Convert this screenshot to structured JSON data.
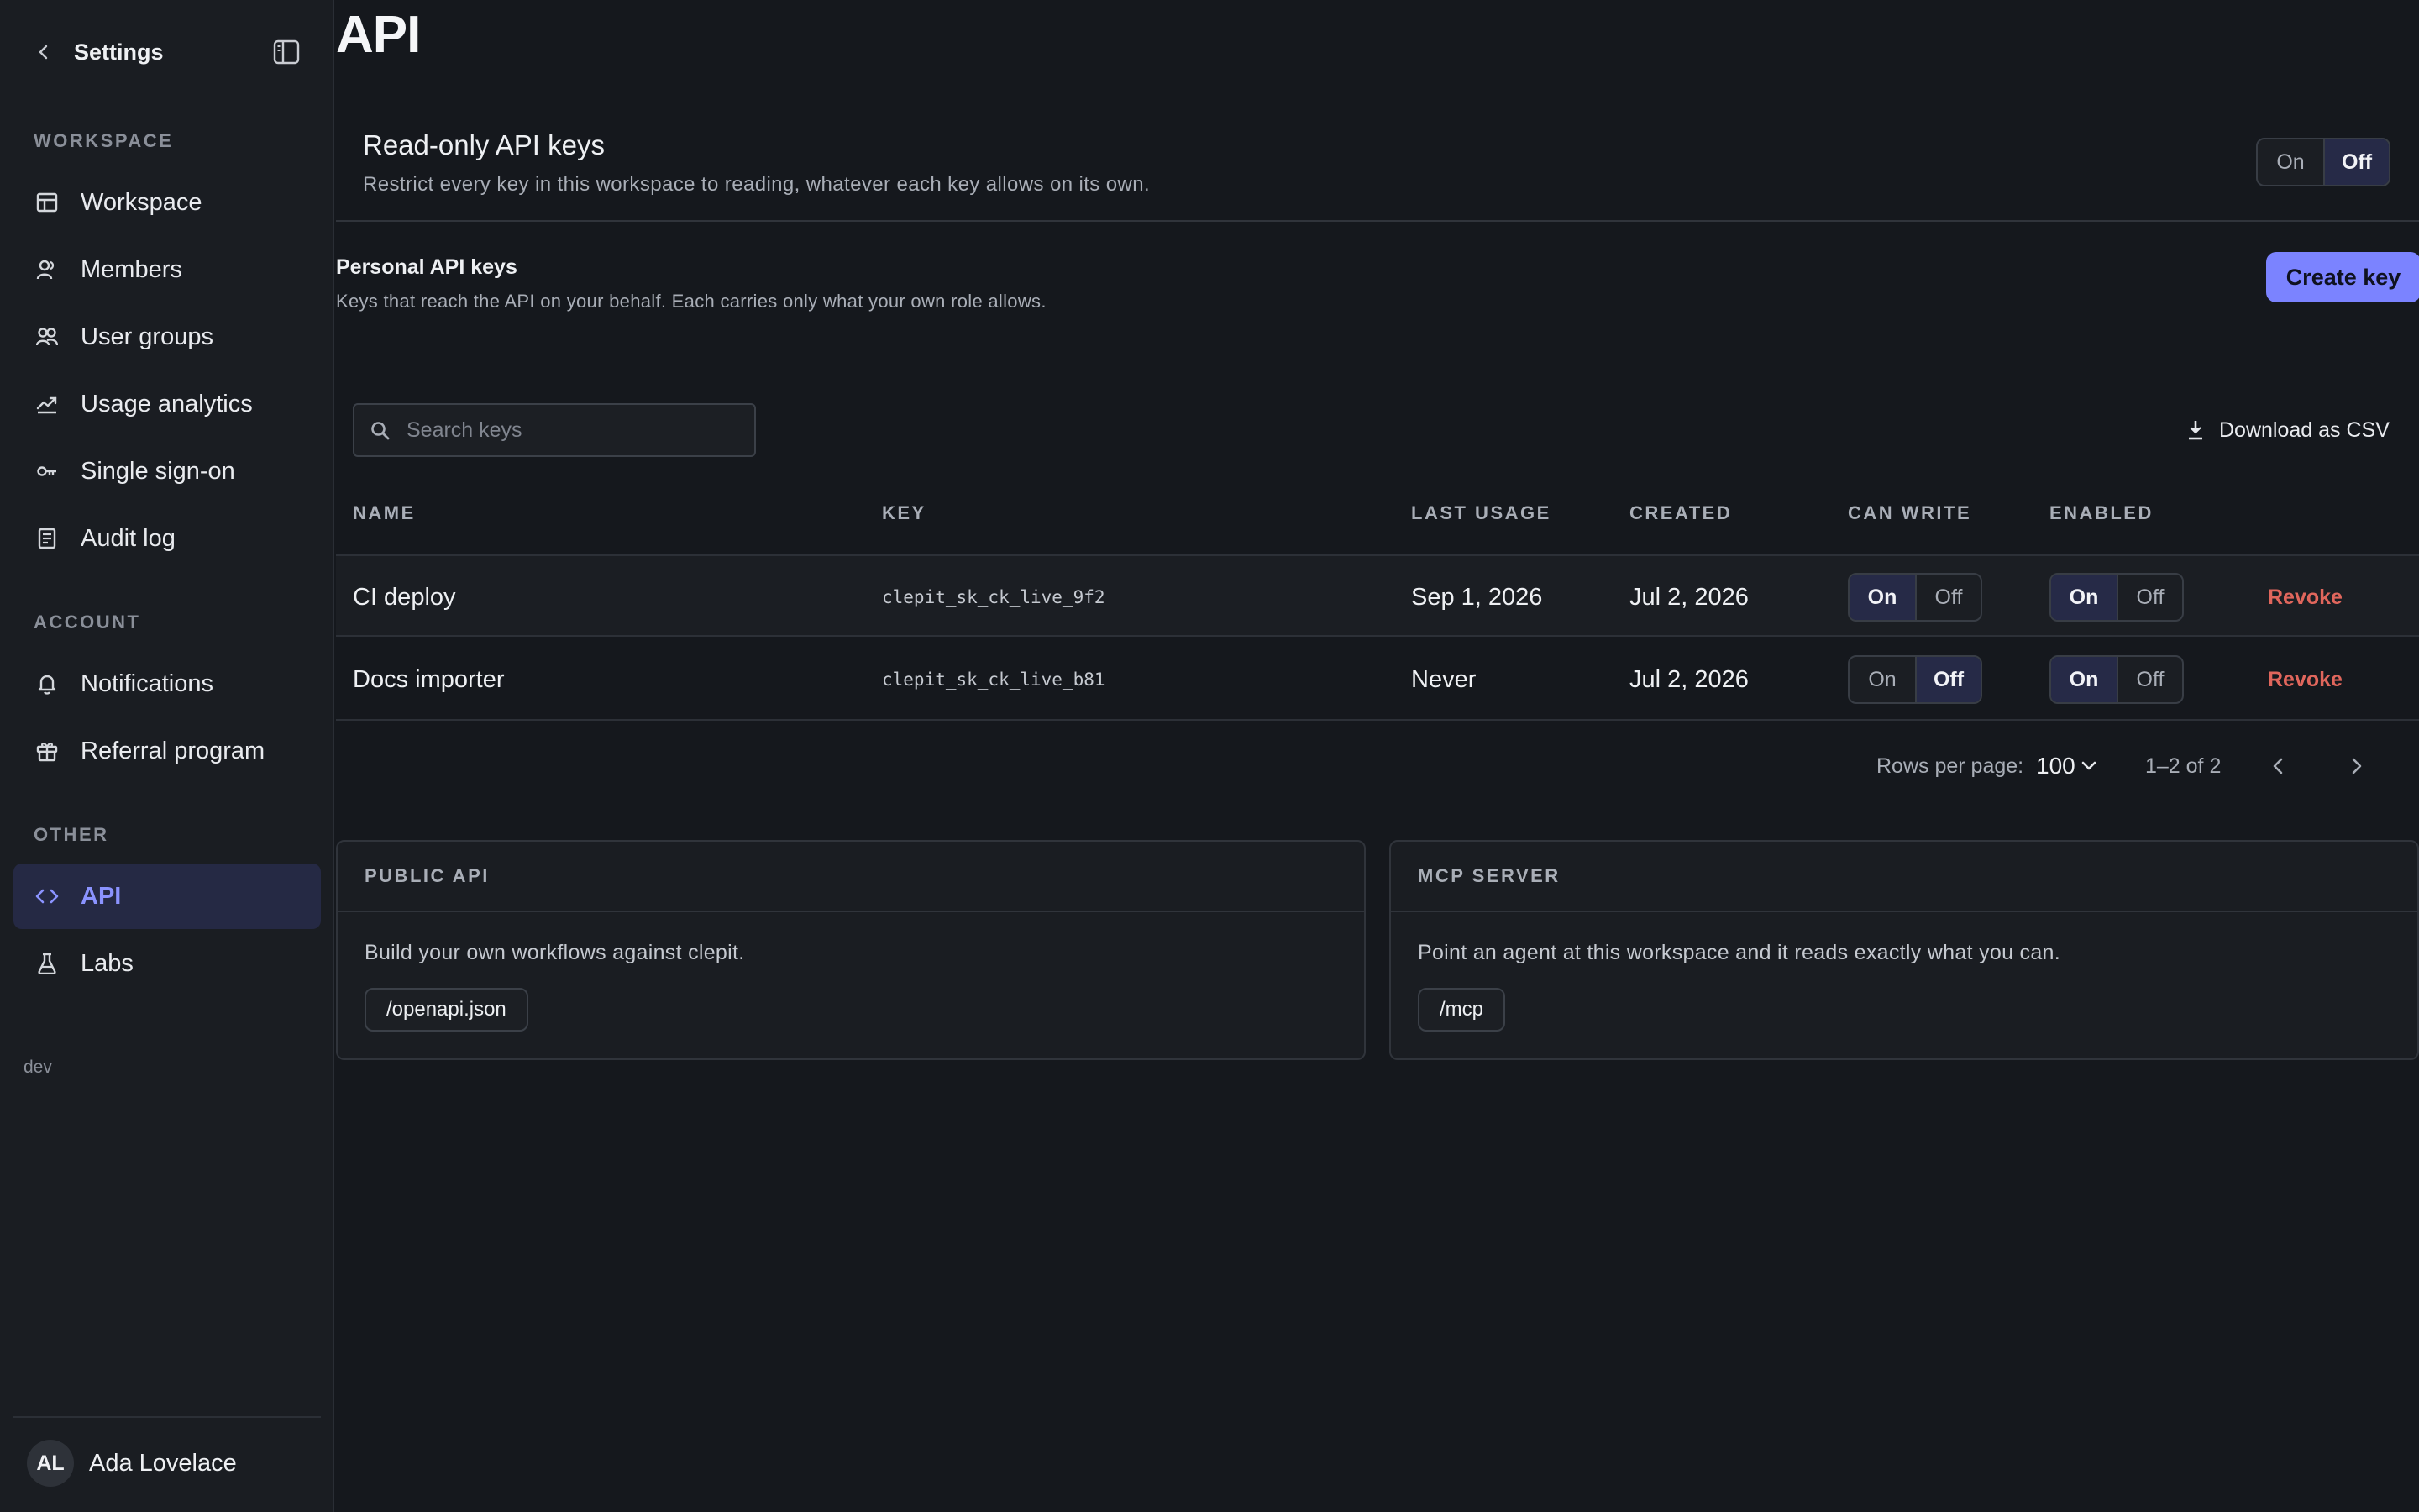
{
  "sidebar": {
    "title": "Settings",
    "sections": {
      "workspace": "WORKSPACE",
      "account": "ACCOUNT",
      "other": "OTHER"
    },
    "items": [
      {
        "label": "Workspace",
        "icon": "layout-icon"
      },
      {
        "label": "Members",
        "icon": "user-icon"
      },
      {
        "label": "User groups",
        "icon": "users-icon"
      },
      {
        "label": "Usage analytics",
        "icon": "trend-icon"
      },
      {
        "label": "Single sign-on",
        "icon": "key-icon"
      },
      {
        "label": "Audit log",
        "icon": "document-icon"
      },
      {
        "label": "Notifications",
        "icon": "bell-icon"
      },
      {
        "label": "Referral program",
        "icon": "gift-icon"
      },
      {
        "label": "API",
        "icon": "code-icon",
        "active": true
      },
      {
        "label": "Labs",
        "icon": "flask-icon"
      }
    ],
    "env": "dev",
    "user": {
      "initials": "AL",
      "name": "Ada Lovelace"
    }
  },
  "page": {
    "title": "API"
  },
  "readonly": {
    "title": "Read-only API keys",
    "description": "Restrict every key in this workspace to reading, whatever each key allows on its own.",
    "on_label": "On",
    "off_label": "Off",
    "selected": "Off"
  },
  "personal_keys": {
    "title": "Personal API keys",
    "description": "Keys that reach the API on your behalf. Each carries only what your own role allows.",
    "create_button": "Create key",
    "search_placeholder": "Search keys",
    "download_button": "Download as CSV",
    "columns": [
      "NAME",
      "KEY",
      "LAST USAGE",
      "CREATED",
      "CAN WRITE",
      "ENABLED"
    ],
    "rows": [
      {
        "name": "CI deploy",
        "key": "clepit_sk_ck_live_9f2",
        "last_usage": "Sep 1, 2026",
        "created": "Jul 2, 2026",
        "can_write": "On",
        "enabled": "On",
        "action": "Revoke"
      },
      {
        "name": "Docs importer",
        "key": "clepit_sk_ck_live_b81",
        "last_usage": "Never",
        "created": "Jul 2, 2026",
        "can_write": "Off",
        "enabled": "On",
        "action": "Revoke"
      }
    ],
    "toggle_on": "On",
    "toggle_off": "Off",
    "pagination": {
      "rows_per_page_label": "Rows per page:",
      "rows_per_page": "100",
      "range": "1–2 of 2"
    }
  },
  "cards": [
    {
      "title": "PUBLIC API",
      "description": "Build your own workflows against clepit.",
      "link": "/openapi.json"
    },
    {
      "title": "MCP SERVER",
      "description": "Point an agent at this workspace and it reads exactly what you can.",
      "link": "/mcp"
    }
  ],
  "colors": {
    "accent": "#7b83ff",
    "danger": "#e0665c",
    "background": "#15181d"
  }
}
